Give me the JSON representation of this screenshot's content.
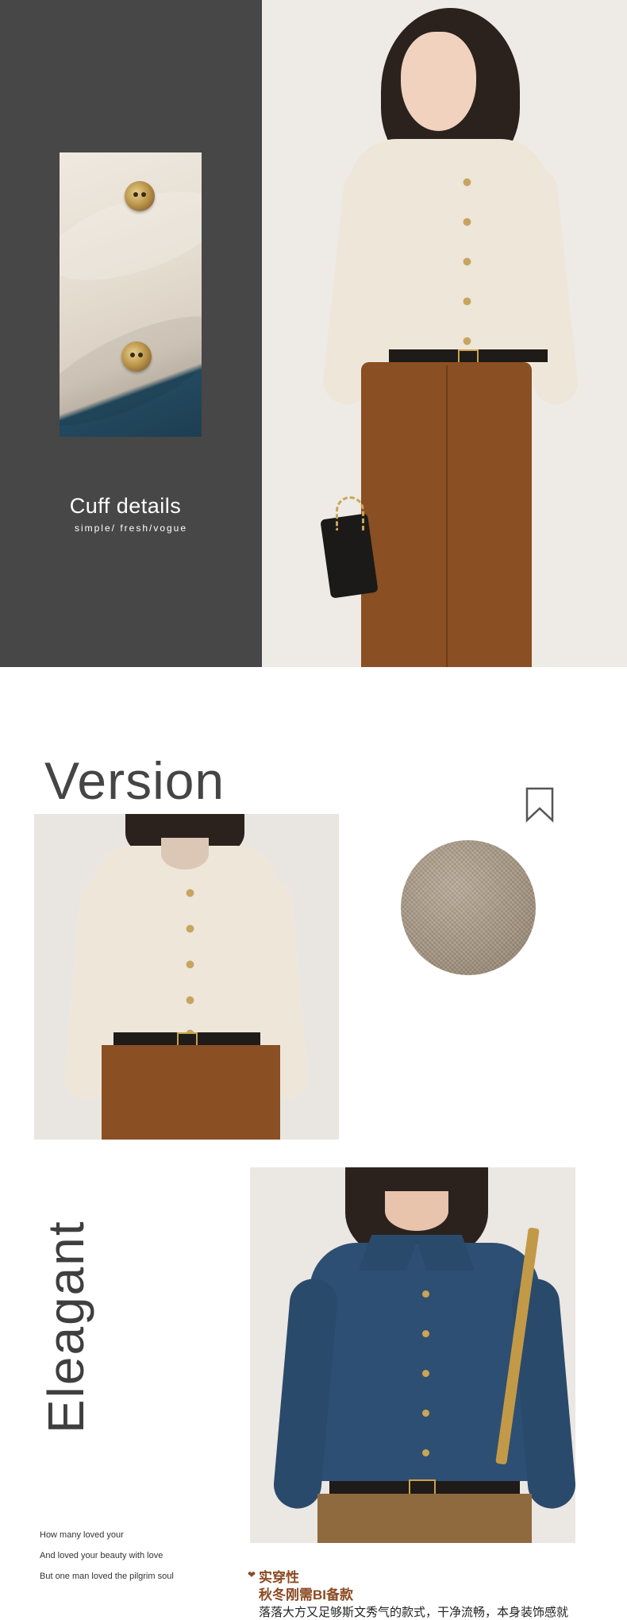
{
  "section_cuff": {
    "title": "Cuff details",
    "subtitle": "simple/ fresh/vogue"
  },
  "section_version": {
    "title": "Version",
    "icon": "bookmark-icon"
  },
  "section_elegant": {
    "vertical_title": "Eleagant",
    "poem": [
      "How many loved your",
      "And loved your beauty with love",
      "But one man loved the pilgrim soul"
    ]
  },
  "feature": {
    "icon": "heart-icon",
    "title": "实穿性",
    "subtitle": "秋冬刚需BI备款",
    "description": "落落大方又足够斯文秀气的款式，干净流畅，本身装饰感就"
  },
  "colors": {
    "dark_panel": "#474747",
    "accent_brown": "#8b4a22",
    "heading_gray": "#454545"
  }
}
